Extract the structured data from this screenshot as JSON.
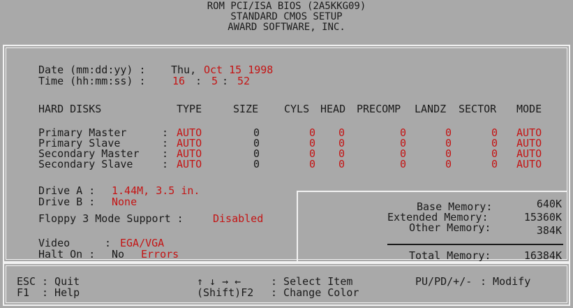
{
  "header": {
    "line1": "ROM PCI/ISA BIOS (2A5KKG09)",
    "line2": "STANDARD CMOS SETUP",
    "line3": "AWARD SOFTWARE, INC."
  },
  "datetime": {
    "date_label": "Date (mm:dd:yy) :",
    "date_day": "Thu,",
    "date_value": "Oct 15 1998",
    "time_label": "Time (hh:mm:ss) :",
    "time_h": "16",
    "time_sep1": ":",
    "time_m": "5",
    "time_sep2": ":",
    "time_s": "52"
  },
  "hdd": {
    "headers": {
      "disks": "HARD DISKS",
      "type": "TYPE",
      "size": "SIZE",
      "cyls": "CYLS",
      "head": "HEAD",
      "precomp": "PRECOMP",
      "landz": "LANDZ",
      "sector": "SECTOR",
      "mode": "MODE"
    },
    "rows": [
      {
        "name": "Primary Master",
        "sep": ":",
        "type": "AUTO",
        "size": "0",
        "cyls": "0",
        "head": "0",
        "precomp": "0",
        "landz": "0",
        "sector": "0",
        "mode": "AUTO"
      },
      {
        "name": "Primary Slave",
        "sep": ":",
        "type": "AUTO",
        "size": "0",
        "cyls": "0",
        "head": "0",
        "precomp": "0",
        "landz": "0",
        "sector": "0",
        "mode": "AUTO"
      },
      {
        "name": "Secondary Master",
        "sep": ":",
        "type": "AUTO",
        "size": "0",
        "cyls": "0",
        "head": "0",
        "precomp": "0",
        "landz": "0",
        "sector": "0",
        "mode": "AUTO"
      },
      {
        "name": "Secondary Slave",
        "sep": ":",
        "type": "AUTO",
        "size": "0",
        "cyls": "0",
        "head": "0",
        "precomp": "0",
        "landz": "0",
        "sector": "0",
        "mode": "AUTO"
      }
    ]
  },
  "drives": {
    "a_label": "Drive A :",
    "a_value": "1.44M, 3.5 in.",
    "b_label": "Drive B :",
    "b_value": "None",
    "floppy_label": "Floppy 3 Mode Support :",
    "floppy_value": "Disabled",
    "video_label": "Video",
    "video_sep": ":",
    "video_value": "EGA/VGA",
    "halt_label": "Halt On :",
    "halt_value_a": "No",
    "halt_value_b": "Errors"
  },
  "memory": {
    "base_label": "Base Memory:",
    "base_value": "640K",
    "ext_label": "Extended Memory:",
    "ext_value": "15360K",
    "other_label": "Other Memory:",
    "other_value": "384K",
    "total_label": "Total Memory:",
    "total_value": "16384K"
  },
  "footer": {
    "esc_key": "ESC",
    "esc_text": ": Quit",
    "f1_key": "F1",
    "f1_text": ": Help",
    "arrows": "↑ ↓ → ←",
    "select_text": ": Select Item",
    "shift_key": "(Shift)F2",
    "change_text": ": Change Color",
    "modify_key": "PU/PD/+/-",
    "modify_text": ": Modify"
  }
}
